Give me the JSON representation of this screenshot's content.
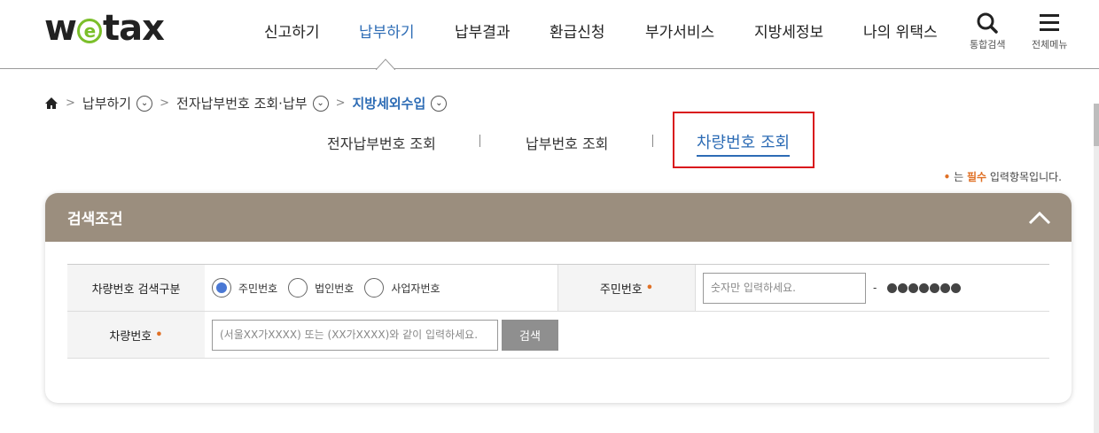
{
  "logo": {
    "pre": "w",
    "e": "e",
    "post": "tax"
  },
  "gnb": [
    {
      "label": "신고하기",
      "active": false
    },
    {
      "label": "납부하기",
      "active": true
    },
    {
      "label": "납부결과",
      "active": false
    },
    {
      "label": "환급신청",
      "active": false
    },
    {
      "label": "부가서비스",
      "active": false
    },
    {
      "label": "지방세정보",
      "active": false
    },
    {
      "label": "나의 위택스",
      "active": false
    }
  ],
  "util": {
    "search_label": "통합검색",
    "menu_label": "전체메뉴"
  },
  "breadcrumb": {
    "item1": "납부하기",
    "item2": "전자납부번호 조회·납부",
    "current": "지방세외수입"
  },
  "subtabs": {
    "tab1": "전자납부번호 조회",
    "tab2": "납부번호 조회",
    "tab3": "차량번호 조회"
  },
  "required_note": {
    "prefix": "는 ",
    "req": "필수",
    "suffix": " 입력항목입니다."
  },
  "panel": {
    "title": "검색조건",
    "search_type_label": "차량번호 검색구분",
    "radios": [
      "주민번호",
      "법인번호",
      "사업자번호"
    ],
    "selected_radio": "주민번호",
    "resident_label": "주민번호",
    "resident_placeholder": "숫자만 입력하세요.",
    "resident_dash": "-",
    "vehicle_label": "차량번호",
    "vehicle_placeholder": "(서울XX가XXXX) 또는 (XX가XXXX)와 같이 입력하세요.",
    "search_button": "검색"
  },
  "colors": {
    "accent": "#2d6cb5",
    "panel_header": "#9b8e7e",
    "required": "#e07025",
    "highlight": "#d9161c"
  }
}
